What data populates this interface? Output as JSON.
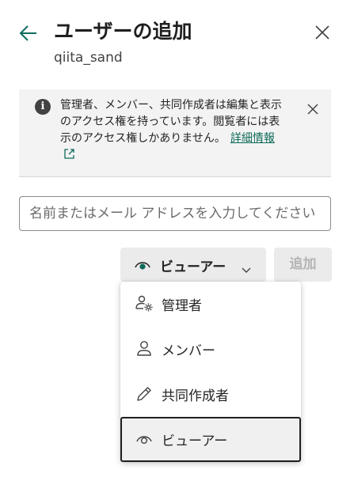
{
  "header": {
    "title": "ユーザーの追加",
    "subtitle": "qiita_sand"
  },
  "info": {
    "text": "管理者、メンバー、共同作成者は編集と表示のアクセス権を持っています。閲覧者には表示のアクセス権しかありません。",
    "link_label": "詳細情報"
  },
  "search": {
    "placeholder": "名前またはメール アドレスを入力してください"
  },
  "role": {
    "selected": "ビューアー"
  },
  "add_button": {
    "label": "追加"
  },
  "menu": {
    "items": [
      {
        "label": "管理者",
        "icon": "admin-people-gear-icon"
      },
      {
        "label": "メンバー",
        "icon": "person-icon"
      },
      {
        "label": "共同作成者",
        "icon": "pencil-icon"
      },
      {
        "label": "ビューアー",
        "icon": "eye-icon"
      }
    ]
  },
  "colors": {
    "accent": "#0f6b5c",
    "panel": "#f3f3f3",
    "button_bg": "#ebebeb",
    "disabled_text": "#b3b3b3"
  }
}
